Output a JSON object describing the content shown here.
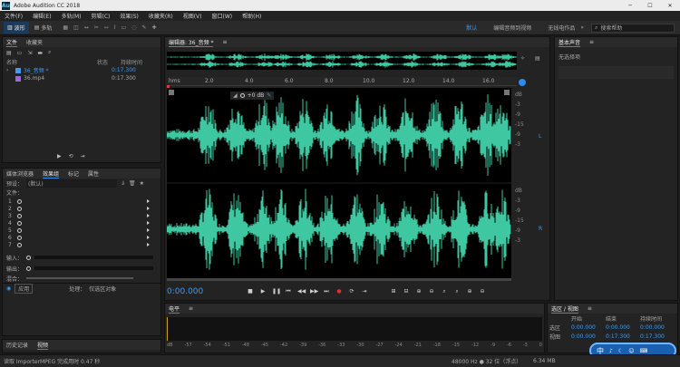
{
  "app": {
    "title": "Adobe Audition CC 2018",
    "win_min": "─",
    "win_max": "☐",
    "win_close": "✕"
  },
  "menu": [
    "文件(F)",
    "编辑(E)",
    "多轨(M)",
    "剪辑(C)",
    "效果(S)",
    "收藏夹(R)",
    "视图(V)",
    "窗口(W)",
    "帮助(H)"
  ],
  "toolbar": {
    "waveform": "波形",
    "multitrack": "多轨",
    "workspaces": [
      "默认",
      "编辑音频到视频",
      "无线电作品"
    ],
    "search_placeholder": "搜索帮助"
  },
  "files_panel": {
    "tabs": [
      "文件",
      "收藏夹"
    ],
    "cols": [
      "名称",
      "状态",
      "持续时间"
    ],
    "items": [
      {
        "name": "36_音频 *",
        "duration": "0:17.300"
      },
      {
        "name": "36.mp4",
        "duration": "0:17.300"
      }
    ]
  },
  "effects_panel": {
    "tabs": [
      "媒体浏览器",
      "效果组",
      "标记",
      "属性"
    ],
    "preset_label": "预设：",
    "preset_value": "(默认)",
    "file_label": "文件：",
    "tracks": [
      "1",
      "2",
      "3",
      "4",
      "5",
      "6",
      "7"
    ],
    "in_label": "输入：",
    "out_label": "输出：",
    "mix_label": "混合：",
    "process_label": "处理：",
    "process_value": "仅选区对象",
    "apply": "应用"
  },
  "history_panel": {
    "tabs": [
      "历史记录",
      "视频"
    ]
  },
  "editor": {
    "tab": "编辑器: 36_音频 *",
    "hud": "+0 dB",
    "timecode": "0:00.000",
    "ruler": [
      "hms",
      "2.0",
      "4.0",
      "6.0",
      "8.0",
      "10.0",
      "12.0",
      "14.0",
      "16.0"
    ],
    "db_scale_top": [
      "dB",
      "-3",
      "-9",
      "-15",
      "-9",
      "-3"
    ],
    "db_scale_bot": [
      "dB",
      "-3",
      "-9",
      "-15",
      "-9",
      "-3"
    ],
    "ch_L": "L",
    "ch_R": "R"
  },
  "properties_panel": {
    "tabs": [
      "基本声音"
    ],
    "empty": "无选择项"
  },
  "level_panel": {
    "title": "电平",
    "scale": [
      "dB",
      "-57",
      "-54",
      "-51",
      "-48",
      "-45",
      "-42",
      "-39",
      "-36",
      "-33",
      "-30",
      "-27",
      "-24",
      "-21",
      "-18",
      "-15",
      "-12",
      "-9",
      "-6",
      "-3",
      "0"
    ]
  },
  "selection_panel": {
    "title": "选区 / 视图",
    "cols": [
      "开始",
      "结束",
      "持续时间"
    ],
    "rows": [
      {
        "label": "选区",
        "start": "0:00.000",
        "end": "0:00.000",
        "dur": "0:00.000"
      },
      {
        "label": "视图",
        "start": "0:00.000",
        "end": "0:17.300",
        "dur": "0:17.300"
      }
    ]
  },
  "status": {
    "left": "读取 ImporterMPEG 完成用时 0.47 秒",
    "format": "48000 Hz ● 32 位（浮点）",
    "size": "6.34 MB",
    "ime": "中"
  },
  "colors": {
    "wave": "#3ec7a0",
    "accent": "#2d8ceb"
  }
}
